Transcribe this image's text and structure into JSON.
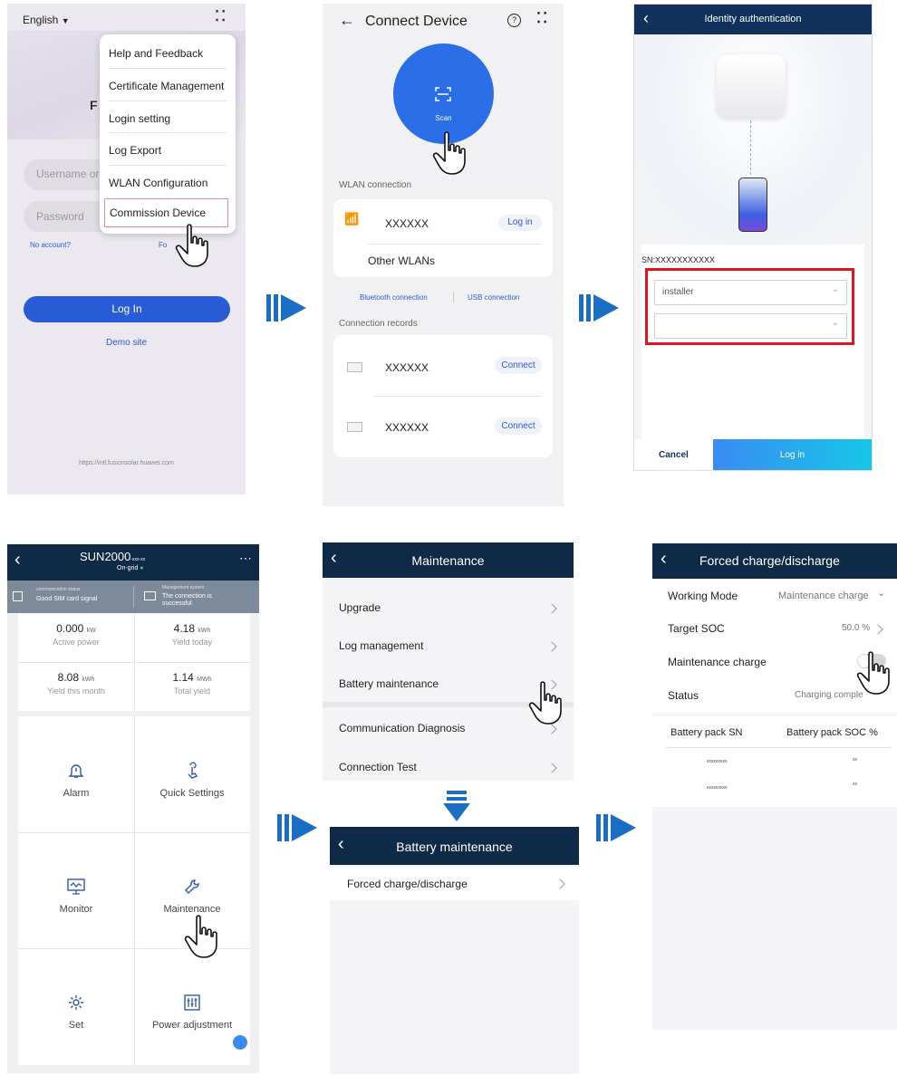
{
  "login": {
    "language": "English",
    "menu_items": [
      "Help and Feedback",
      "Certificate Management",
      "Login setting",
      "Log Export",
      "WLAN Configuration",
      "Commission Device"
    ],
    "username_placeholder": "Username or",
    "password_placeholder": "Password",
    "no_account": "No account?",
    "forgot_password": "Fo          word?",
    "login_button": "Log In",
    "demo_site": "Demo site",
    "url": "https://intl.fusionsolar.huawei.com"
  },
  "connect": {
    "title": "Connect Device",
    "scan_label": "Scan",
    "wlan_section": "WLAN connection",
    "wlan_name": "XXXXXX",
    "login_link": "Log in",
    "other_wlans": "Other WLANs",
    "bluetooth": "Bluetooth connection",
    "usb": "USB connection",
    "records_section": "Connection records",
    "records": [
      {
        "name": "XXXXXX",
        "action": "Connect"
      },
      {
        "name": "XXXXXX",
        "action": "Connect"
      }
    ]
  },
  "auth": {
    "title": "Identity authentication",
    "sn": "SN:XXXXXXXXXXX",
    "user_value": "installer",
    "cancel": "Cancel",
    "login": "Log in"
  },
  "device": {
    "title": "SUN2000",
    "model_suffix": "-xxx-xx",
    "grid_status": "On-grid",
    "comm_label": "communication status",
    "comm_value": "Good SIM card signal",
    "mgmt_label": "Management system",
    "mgmt_value": "The connection is successful",
    "stats": [
      {
        "value": "0.000",
        "unit": "kW",
        "label": "Active power"
      },
      {
        "value": "4.18",
        "unit": "kWh",
        "label": "Yield today"
      },
      {
        "value": "8.08",
        "unit": "kWh",
        "label": "Yield this month"
      },
      {
        "value": "1.14",
        "unit": "MWh",
        "label": "Total yield"
      }
    ],
    "tiles": [
      "Alarm",
      "Quick Settings",
      "Monitor",
      "Maintenance",
      "Set",
      "Power adjustment"
    ]
  },
  "maintenance": {
    "title": "Maintenance",
    "items": [
      "Upgrade",
      "Log management",
      "Battery maintenance",
      "Communication Diagnosis",
      "Connection Test"
    ]
  },
  "battery": {
    "title": "Battery maintenance",
    "item": "Forced charge/discharge"
  },
  "forced": {
    "title": "Forced charge/discharge",
    "working_mode_label": "Working Mode",
    "working_mode_value": "Maintenance charge",
    "target_soc_label": "Target SOC",
    "target_soc_value": "50.0 %",
    "maintenance_charge_label": "Maintenance charge",
    "status_label": "Status",
    "status_value": "Charging comple",
    "col_sn": "Battery pack SN",
    "col_soc": "Battery pack SOC %",
    "rows": [
      {
        "sn": "xxxxxxxxx",
        "soc": "xx"
      },
      {
        "sn": "xxxxxxxxx",
        "soc": "xx"
      }
    ]
  },
  "colors": {
    "accent": "#2a5bd7",
    "navy": "#0e2a47",
    "arrow": "#1a6fc4",
    "highlight": "#e0141e"
  }
}
